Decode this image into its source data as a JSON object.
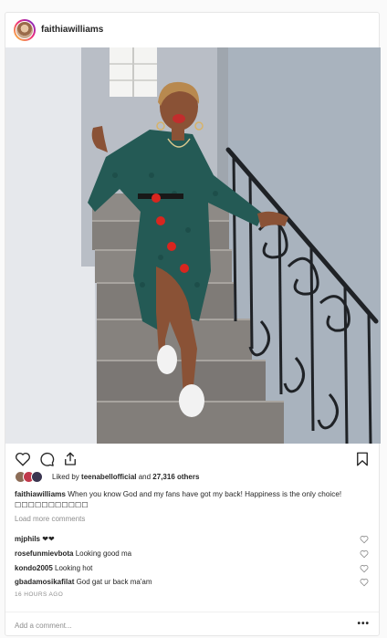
{
  "post": {
    "username": "faithiawilliams",
    "photo_icon": "photo-of-woman-on-stairs",
    "likes": {
      "prefix": "Liked by ",
      "liker": "teenabellofficial",
      "connector": " and ",
      "others": "27,316 others"
    },
    "caption": {
      "username": "faithiawilliams",
      "text": " When you know God and my fans have got my back! Happiness is the only choice! ☐☐☐☐☐☐☐☐☐☐☐"
    },
    "load_more": "Load more comments",
    "comments": [
      {
        "username": "mjphils",
        "text": " ❤❤"
      },
      {
        "username": "rosefunmievbota",
        "text": " Looking good ma"
      },
      {
        "username": "kondo2005",
        "text": " Looking hot"
      },
      {
        "username": "gbadamosikafilat",
        "text": " God gat ur back ma'am"
      }
    ],
    "timestamp": "16 HOURS AGO",
    "add_comment_placeholder": "Add a comment...",
    "more_options": "•••"
  },
  "icons": {
    "like": "heart-icon",
    "comment": "comment-icon",
    "share": "share-icon",
    "save": "bookmark-icon"
  }
}
